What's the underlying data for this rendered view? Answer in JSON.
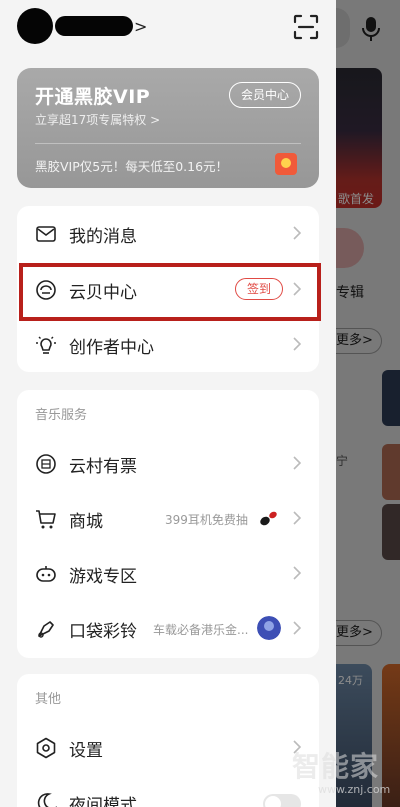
{
  "header": {
    "username_chevron": ">",
    "scan_icon": "scan-icon"
  },
  "vip": {
    "title": "开通黑胶VIP",
    "subtitle": "立享超17项专属特权 >",
    "center_button": "会员中心",
    "promo": "黑胶VIP仅5元！每天低至0.16元！"
  },
  "main_menu": [
    {
      "label": "我的消息",
      "icon": "mail-icon"
    },
    {
      "label": "云贝中心",
      "icon": "cloud-coin-icon",
      "badge": "签到"
    },
    {
      "label": "创作者中心",
      "icon": "lightbulb-icon"
    }
  ],
  "music_services": {
    "title": "音乐服务",
    "items": [
      {
        "label": "云村有票",
        "icon": "ticket-icon"
      },
      {
        "label": "商城",
        "icon": "cart-icon",
        "extra": "399耳机免费抽"
      },
      {
        "label": "游戏专区",
        "icon": "gamepad-icon"
      },
      {
        "label": "口袋彩铃",
        "icon": "ringtone-icon",
        "extra": "车载必备港乐金..."
      }
    ]
  },
  "other": {
    "title": "其他",
    "items": [
      {
        "label": "设置",
        "icon": "settings-icon"
      },
      {
        "label": "夜间模式",
        "icon": "moon-icon"
      }
    ]
  },
  "background": {
    "album_tag": "歌首发",
    "circle_label": "专辑",
    "more_1": "更多>",
    "more_2": "更多>",
    "side_text_1": "宁",
    "tile_label": "24万"
  },
  "watermark": {
    "text": "智能家",
    "url": "www.znj.com"
  },
  "colors": {
    "accent_red": "#e04a44",
    "highlight_border": "#b8201b",
    "vip_card_bg": "#a9a9a9"
  }
}
